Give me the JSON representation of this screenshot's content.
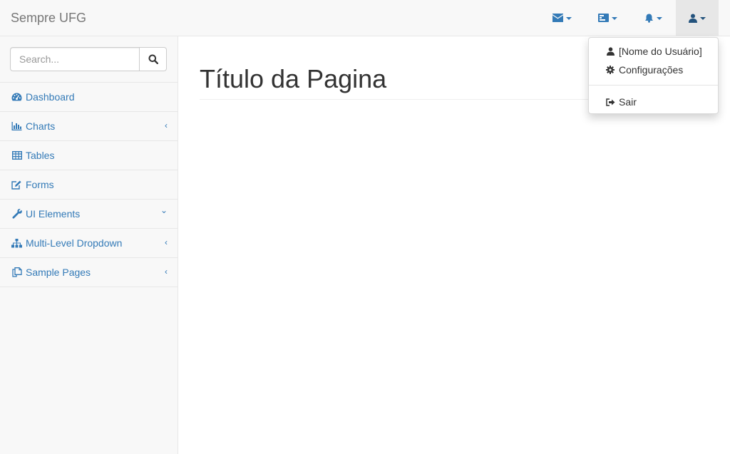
{
  "navbar": {
    "brand": "Sempre UFG",
    "buttons": [
      {
        "icon": "envelope-icon"
      },
      {
        "icon": "tasks-icon"
      },
      {
        "icon": "bell-icon"
      },
      {
        "icon": "user-icon"
      }
    ]
  },
  "sidebar": {
    "search": {
      "placeholder": "Search...",
      "value": ""
    },
    "items": [
      {
        "label": "Dashboard",
        "icon": "dashboard-icon",
        "arrow": ""
      },
      {
        "label": "Charts",
        "icon": "bar-chart-icon",
        "arrow": "‹"
      },
      {
        "label": "Tables",
        "icon": "table-icon",
        "arrow": ""
      },
      {
        "label": "Forms",
        "icon": "edit-icon",
        "arrow": ""
      },
      {
        "label": "UI Elements",
        "icon": "wrench-icon",
        "arrow": "⌄"
      },
      {
        "label": "Multi-Level Dropdown",
        "icon": "sitemap-icon",
        "arrow": "‹"
      },
      {
        "label": "Sample Pages",
        "icon": "files-icon",
        "arrow": "‹"
      }
    ]
  },
  "main": {
    "title": "Título da Pagina"
  },
  "user_menu": {
    "items": [
      {
        "label": "[Nome do Usuário]",
        "icon": "user-icon"
      },
      {
        "label": "Configurações",
        "icon": "gear-icon"
      },
      {
        "label": "Sair",
        "icon": "sign-out-icon"
      }
    ]
  },
  "colors": {
    "link": "#337ab7",
    "navbar_bg": "#f8f8f8",
    "border": "#e7e7e7"
  }
}
